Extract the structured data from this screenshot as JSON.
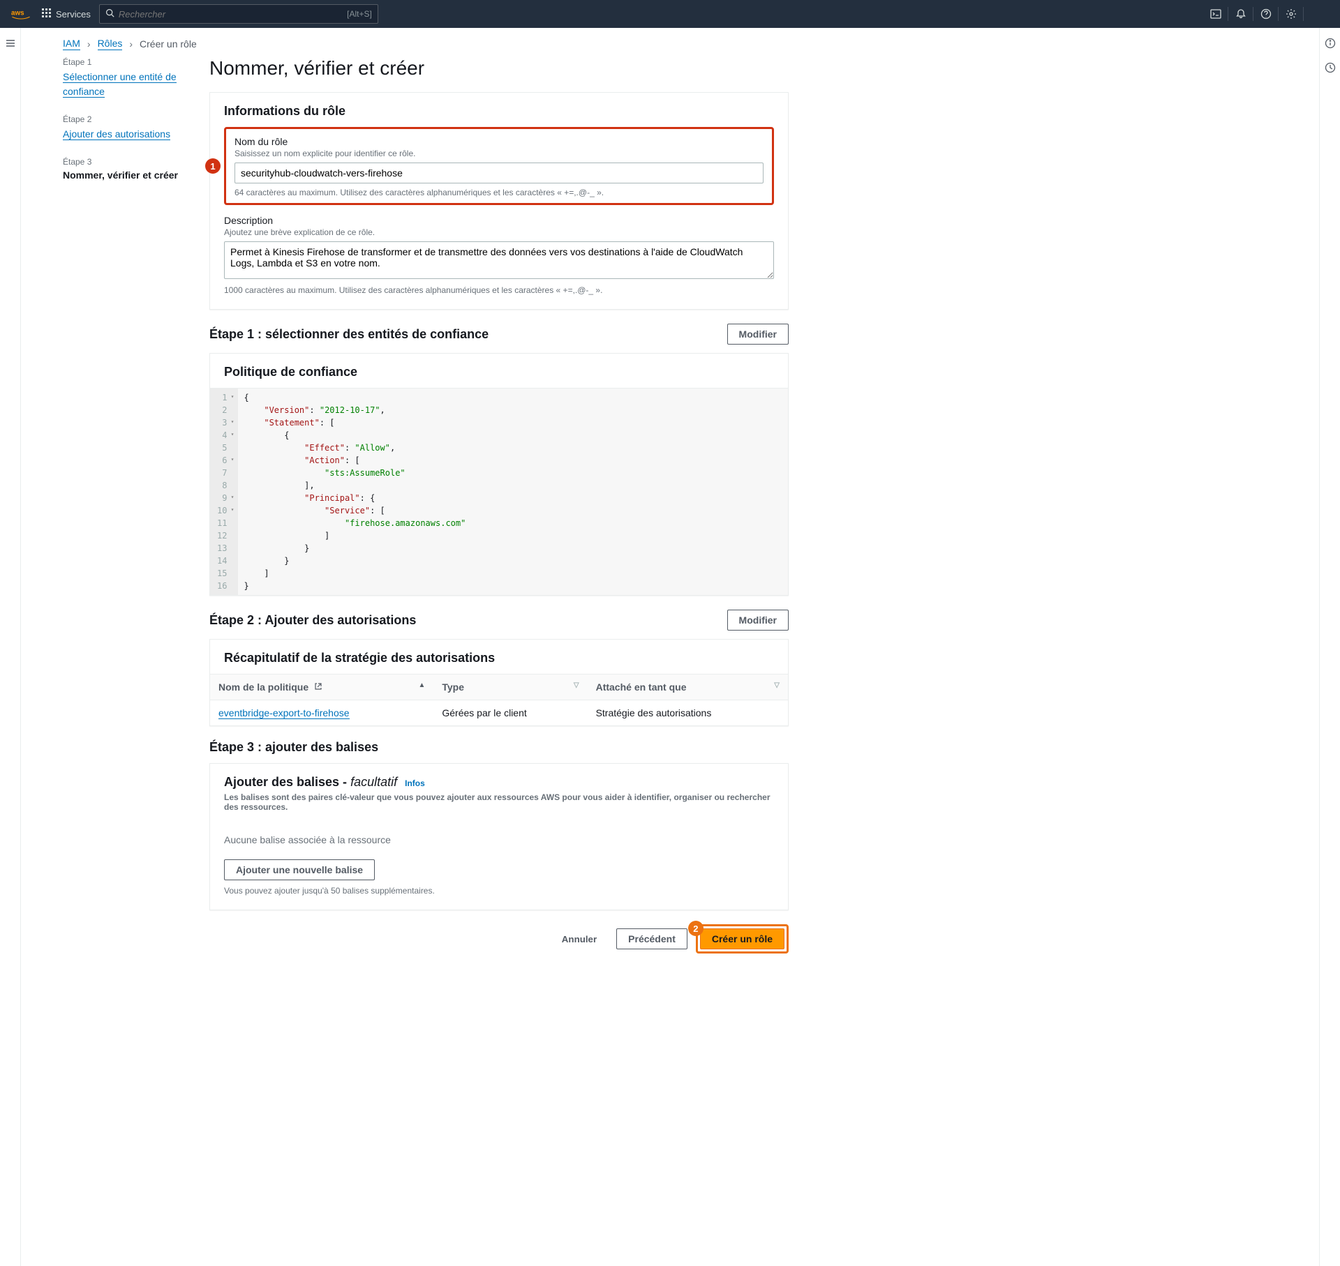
{
  "topnav": {
    "services_label": "Services",
    "search_placeholder": "Rechercher",
    "search_shortcut": "[Alt+S]"
  },
  "breadcrumb": {
    "iam": "IAM",
    "roles": "Rôles",
    "current": "Créer un rôle"
  },
  "steps": {
    "s1_label": "Étape 1",
    "s1_link": "Sélectionner une entité de confiance",
    "s2_label": "Étape 2",
    "s2_link": "Ajouter des autorisations",
    "s3_label": "Étape 3",
    "s3_text": "Nommer, vérifier et créer"
  },
  "page_title": "Nommer, vérifier et créer",
  "role_info": {
    "panel_title": "Informations du rôle",
    "name_label": "Nom du rôle",
    "name_hint": "Saisissez un nom explicite pour identifier ce rôle.",
    "name_value": "securityhub-cloudwatch-vers-firehose",
    "name_constraint": "64 caractères au maximum. Utilisez des caractères alphanumériques et les caractères « +=,.@-_ ».",
    "desc_label": "Description",
    "desc_hint": "Ajoutez une brève explication de ce rôle.",
    "desc_value": "Permet à Kinesis Firehose de transformer et de transmettre des données vers vos destinations à l'aide de CloudWatch Logs, Lambda et S3 en votre nom.",
    "desc_constraint": "1000 caractères au maximum. Utilisez des caractères alphanumériques et les caractères « +=,.@-_ »."
  },
  "step1_section": {
    "title": "Étape 1 : sélectionner des entités de confiance",
    "edit_btn": "Modifier",
    "panel_title": "Politique de confiance",
    "code_lines": [
      "{",
      "    \"Version\": \"2012-10-17\",",
      "    \"Statement\": [",
      "        {",
      "            \"Effect\": \"Allow\",",
      "            \"Action\": [",
      "                \"sts:AssumeRole\"",
      "            ],",
      "            \"Principal\": {",
      "                \"Service\": [",
      "                    \"firehose.amazonaws.com\"",
      "                ]",
      "            }",
      "        }",
      "    ]",
      "}"
    ]
  },
  "step2_section": {
    "title": "Étape 2 : Ajouter des autorisations",
    "edit_btn": "Modifier",
    "panel_title": "Récapitulatif de la stratégie des autorisations",
    "col_policy": "Nom de la politique",
    "col_type": "Type",
    "col_attached": "Attaché en tant que",
    "row_policy": "eventbridge-export-to-firehose",
    "row_type": "Gérées par le client",
    "row_attached": "Stratégie des autorisations"
  },
  "step3_section": {
    "title": "Étape 3 : ajouter des balises",
    "panel_title": "Ajouter des balises - ",
    "optional": "facultatif",
    "infos": "Infos",
    "desc": "Les balises sont des paires clé-valeur que vous pouvez ajouter aux ressources AWS pour vous aider à identifier, organiser ou rechercher des ressources.",
    "empty": "Aucune balise associée à la ressource",
    "add_btn": "Ajouter une nouvelle balise",
    "limit": "Vous pouvez ajouter jusqu'à 50 balises supplémentaires."
  },
  "footer": {
    "cancel": "Annuler",
    "previous": "Précédent",
    "create": "Créer un rôle"
  },
  "callouts": {
    "one": "1",
    "two": "2"
  }
}
